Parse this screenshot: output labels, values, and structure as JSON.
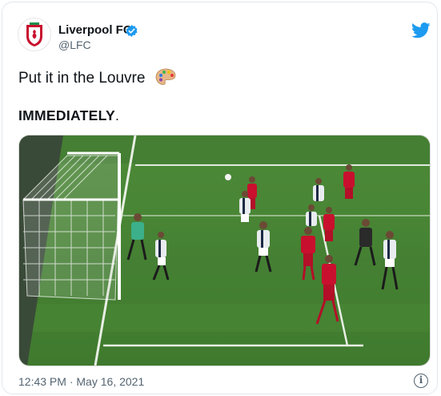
{
  "author": {
    "name": "Liverpool FC",
    "handle": "@LFC",
    "verified": true,
    "avatar_icon": "lfc-crest-icon"
  },
  "tweet": {
    "line1": "Put it in the Louvre",
    "line1_emoji_icon": "artist-palette-icon",
    "line2_bold": "IMMEDIATELY",
    "line2_end": "."
  },
  "media": {
    "type": "photo",
    "description_icon": "football-match-photo"
  },
  "meta": {
    "time": "12:43 PM",
    "separator": " · ",
    "date": "May 16, 2021"
  },
  "colors": {
    "twitter_blue": "#1d9bf0",
    "text": "#0f1419",
    "muted": "#536471",
    "lfc_red": "#c8102e"
  }
}
